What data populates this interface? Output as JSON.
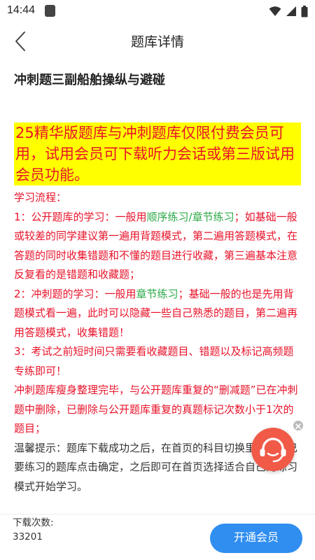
{
  "status_bar": {
    "time": "14:44"
  },
  "nav": {
    "title": "题库详情"
  },
  "library": {
    "title": "冲刺题三副船舶操纵与避碰",
    "notice": "25精华版题库与冲刺题库仅限付费会员可用，试用会员可下载听力会话或第三版试用会员功能。",
    "flow_heading": "学习流程：",
    "step1_a": "1：公开题库的学习：一般用",
    "step1_link": "顺序练习/章节练习",
    "step1_b": "；如基础一般或较差的同学建议第一遍用背题模式，第二遍用答题模式，在答题的同时收集错题和不懂的题目进行收藏，第三遍基本注意反复看的是错题和收藏题；",
    "step2_a": "2：冲刺题的学习：一般用",
    "step2_link": "章节练习",
    "step2_b": "；基础一般的也是先用背题模式看一遍，此时可以隐藏一些自己熟悉的题目，第二遍再用答题模式，收集错题！",
    "step3": "3：考试之前短时间只需要看收藏题目、错题以及标记高频题专练即可！",
    "sprint_note": "冲刺题库瘦身整理完毕，与公开题库重复的“删减题”已在冲刺题中删除，已删除与公开题库重复的真题标记次数小于1次的题目；",
    "tip": "温馨提示：题库下载成功之后，在首页的科目切换里选择自己要练习的题库点击确定，之后即可在首页选择适合自己的练习模式开始学习。"
  },
  "bottom": {
    "download_label": "下载次数:",
    "download_count": "33201",
    "vip_button": "开通会员"
  },
  "icons": {
    "back": "chevron-left-icon",
    "service": "headset-icon",
    "close": "close-icon"
  },
  "colors": {
    "accent": "#2f8ef0",
    "notice_bg": "#ffff00",
    "notice_text": "#e8132a",
    "link_green": "#29a845",
    "service_bg": "#f05a47"
  }
}
